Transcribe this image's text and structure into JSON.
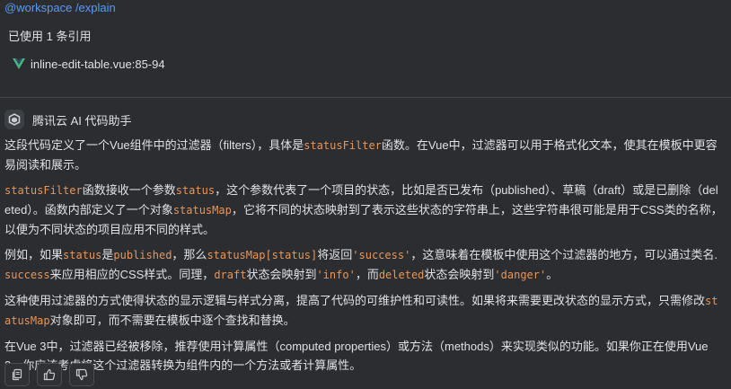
{
  "query": {
    "command": "@workspace /explain",
    "references_label": "已使用 1 条引用",
    "file_reference": "inline-edit-table.vue:85-94",
    "file_icon": "vue-icon"
  },
  "assistant": {
    "name": "腾讯云 AI 代码助手",
    "logo_icon": "tencent-ai-logo-icon",
    "paragraphs": [
      [
        {
          "t": "这段代码定义了一个Vue组件中的过滤器（filters），具体是"
        },
        {
          "t": "statusFilter",
          "code": true
        },
        {
          "t": "函数。在Vue中，过滤器可以用于格式化文本，使其在模板中更容易阅读和展示。"
        }
      ],
      [
        {
          "t": "statusFilter",
          "code": true
        },
        {
          "t": "函数接收一个参数"
        },
        {
          "t": "status",
          "code": true
        },
        {
          "t": "，这个参数代表了一个项目的状态，比如是否已发布（published）、草稿（draft）或是已删除（deleted）。函数内部定义了一个对象"
        },
        {
          "t": "statusMap",
          "code": true
        },
        {
          "t": "，它将不同的状态映射到了表示这些状态的字符串上，这些字符串很可能是用于CSS类的名称，以便为不同状态的项目应用不同的样式。"
        }
      ],
      [
        {
          "t": "例如，如果"
        },
        {
          "t": "status",
          "code": true
        },
        {
          "t": "是"
        },
        {
          "t": "published",
          "code": true
        },
        {
          "t": "，那么"
        },
        {
          "t": "statusMap[status]",
          "code": true
        },
        {
          "t": "将返回"
        },
        {
          "t": "'success'",
          "code": true
        },
        {
          "t": "，这意味着在模板中使用这个过滤器的地方，可以通过类名."
        },
        {
          "t": "success",
          "code": true
        },
        {
          "t": "来应用相应的CSS样式。同理，"
        },
        {
          "t": "draft",
          "code": true
        },
        {
          "t": "状态会映射到"
        },
        {
          "t": "'info'",
          "code": true
        },
        {
          "t": "，而"
        },
        {
          "t": "deleted",
          "code": true
        },
        {
          "t": "状态会映射到"
        },
        {
          "t": "'danger'",
          "code": true
        },
        {
          "t": "。"
        }
      ],
      [
        {
          "t": "这种使用过滤器的方式使得状态的显示逻辑与样式分离，提高了代码的可维护性和可读性。如果将来需要更改状态的显示方式，只需修改"
        },
        {
          "t": "statusMap",
          "code": true
        },
        {
          "t": "对象即可，而不需要在模板中逐个查找和替换。"
        }
      ],
      [
        {
          "t": "在Vue 3中，过滤器已经被移除，推荐使用计算属性（computed properties）或方法（methods）来实现类似的功能。如果你正在使用Vue 3，你应该考虑将这个过滤器转换为组件内的一个方法或者计算属性。"
        }
      ]
    ]
  },
  "actions": [
    {
      "name": "copy-button",
      "icon": "copy-icon"
    },
    {
      "name": "thumbs-up-button",
      "icon": "thumbs-up-icon"
    },
    {
      "name": "thumbs-down-button",
      "icon": "thumbs-down-icon"
    }
  ],
  "colors": {
    "background": "#2b2d30",
    "text": "#dfe1e5",
    "command": "#5a9bf6",
    "inline_code": "#e6965b",
    "vue_green": "#41b883",
    "divider": "#43454a"
  }
}
